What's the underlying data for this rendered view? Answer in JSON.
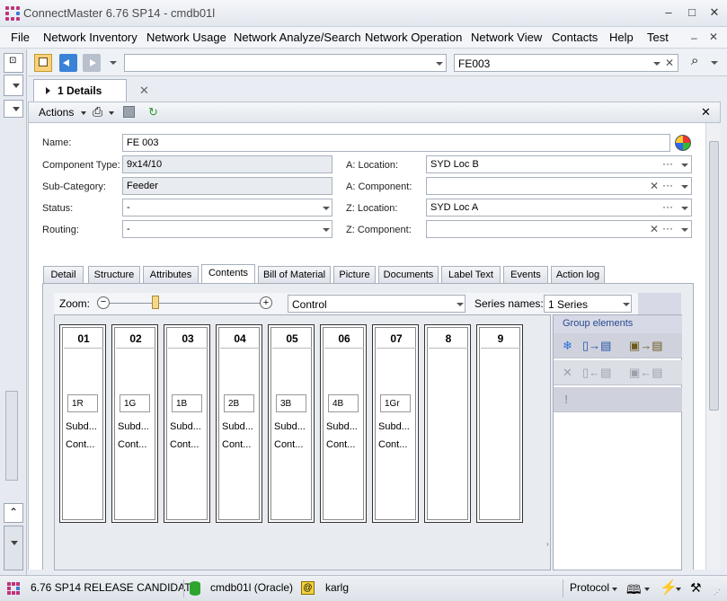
{
  "window": {
    "title": "ConnectMaster 6.76 SP14 - cmdb01l",
    "minimize": "–",
    "maximize": "□",
    "close": "✕"
  },
  "menu": [
    "File",
    "Network Inventory",
    "Network Usage",
    "Network Analyze/Search",
    "Network Operation",
    "Network View",
    "Contacts",
    "Help",
    "Test"
  ],
  "toolbar": {
    "nav_value": "",
    "search_value": "FE003"
  },
  "tab": {
    "label": "1 Details",
    "close": "✕"
  },
  "actionbar": {
    "actions_label": "Actions",
    "close": "✕"
  },
  "form": {
    "name_label": "Name:",
    "name_value": "FE 003",
    "component_type_label": "Component Type:",
    "component_type_value": "9x14/10",
    "sub_category_label": "Sub-Category:",
    "sub_category_value": "Feeder",
    "status_label": "Status:",
    "status_value": "-",
    "routing_label": "Routing:",
    "routing_value": "-",
    "a_location_label": "A: Location:",
    "a_location_value": "SYD Loc B",
    "a_component_label": "A: Component:",
    "a_component_value": "",
    "z_location_label": "Z: Location:",
    "z_location_value": "SYD Loc A",
    "z_component_label": "Z: Component:",
    "z_component_value": ""
  },
  "subtabs": [
    "Detail",
    "Structure",
    "Attributes",
    "Contents",
    "Bill of Material",
    "Picture",
    "Documents",
    "Label Text",
    "Events",
    "Action log"
  ],
  "active_subtab": "Contents",
  "contents": {
    "zoom_label": "Zoom:",
    "zoom_level": 0.3,
    "control_value": "Control",
    "series_label": "Series names:",
    "series_value": "1 Series",
    "columns": [
      {
        "num": "01",
        "code": "1R",
        "line1": "Subd...",
        "line2": "Cont..."
      },
      {
        "num": "02",
        "code": "1G",
        "line1": "Subd...",
        "line2": "Cont..."
      },
      {
        "num": "03",
        "code": "1B",
        "line1": "Subd...",
        "line2": "Cont..."
      },
      {
        "num": "04",
        "code": "2B",
        "line1": "Subd...",
        "line2": "Cont..."
      },
      {
        "num": "05",
        "code": "3B",
        "line1": "Subd...",
        "line2": "Cont..."
      },
      {
        "num": "06",
        "code": "4B",
        "line1": "Subd...",
        "line2": "Cont..."
      },
      {
        "num": "07",
        "code": "1Gr",
        "line1": "Subd...",
        "line2": "Cont..."
      },
      {
        "num": "8",
        "code": "",
        "line1": "",
        "line2": ""
      },
      {
        "num": "9",
        "code": "",
        "line1": "",
        "line2": ""
      }
    ],
    "group_title": "Group elements"
  },
  "status": {
    "version": "6.76 SP14 RELEASE CANDIDATE",
    "database": "cmdb01l (Oracle)",
    "user": "karlg",
    "protocol": "Protocol"
  }
}
